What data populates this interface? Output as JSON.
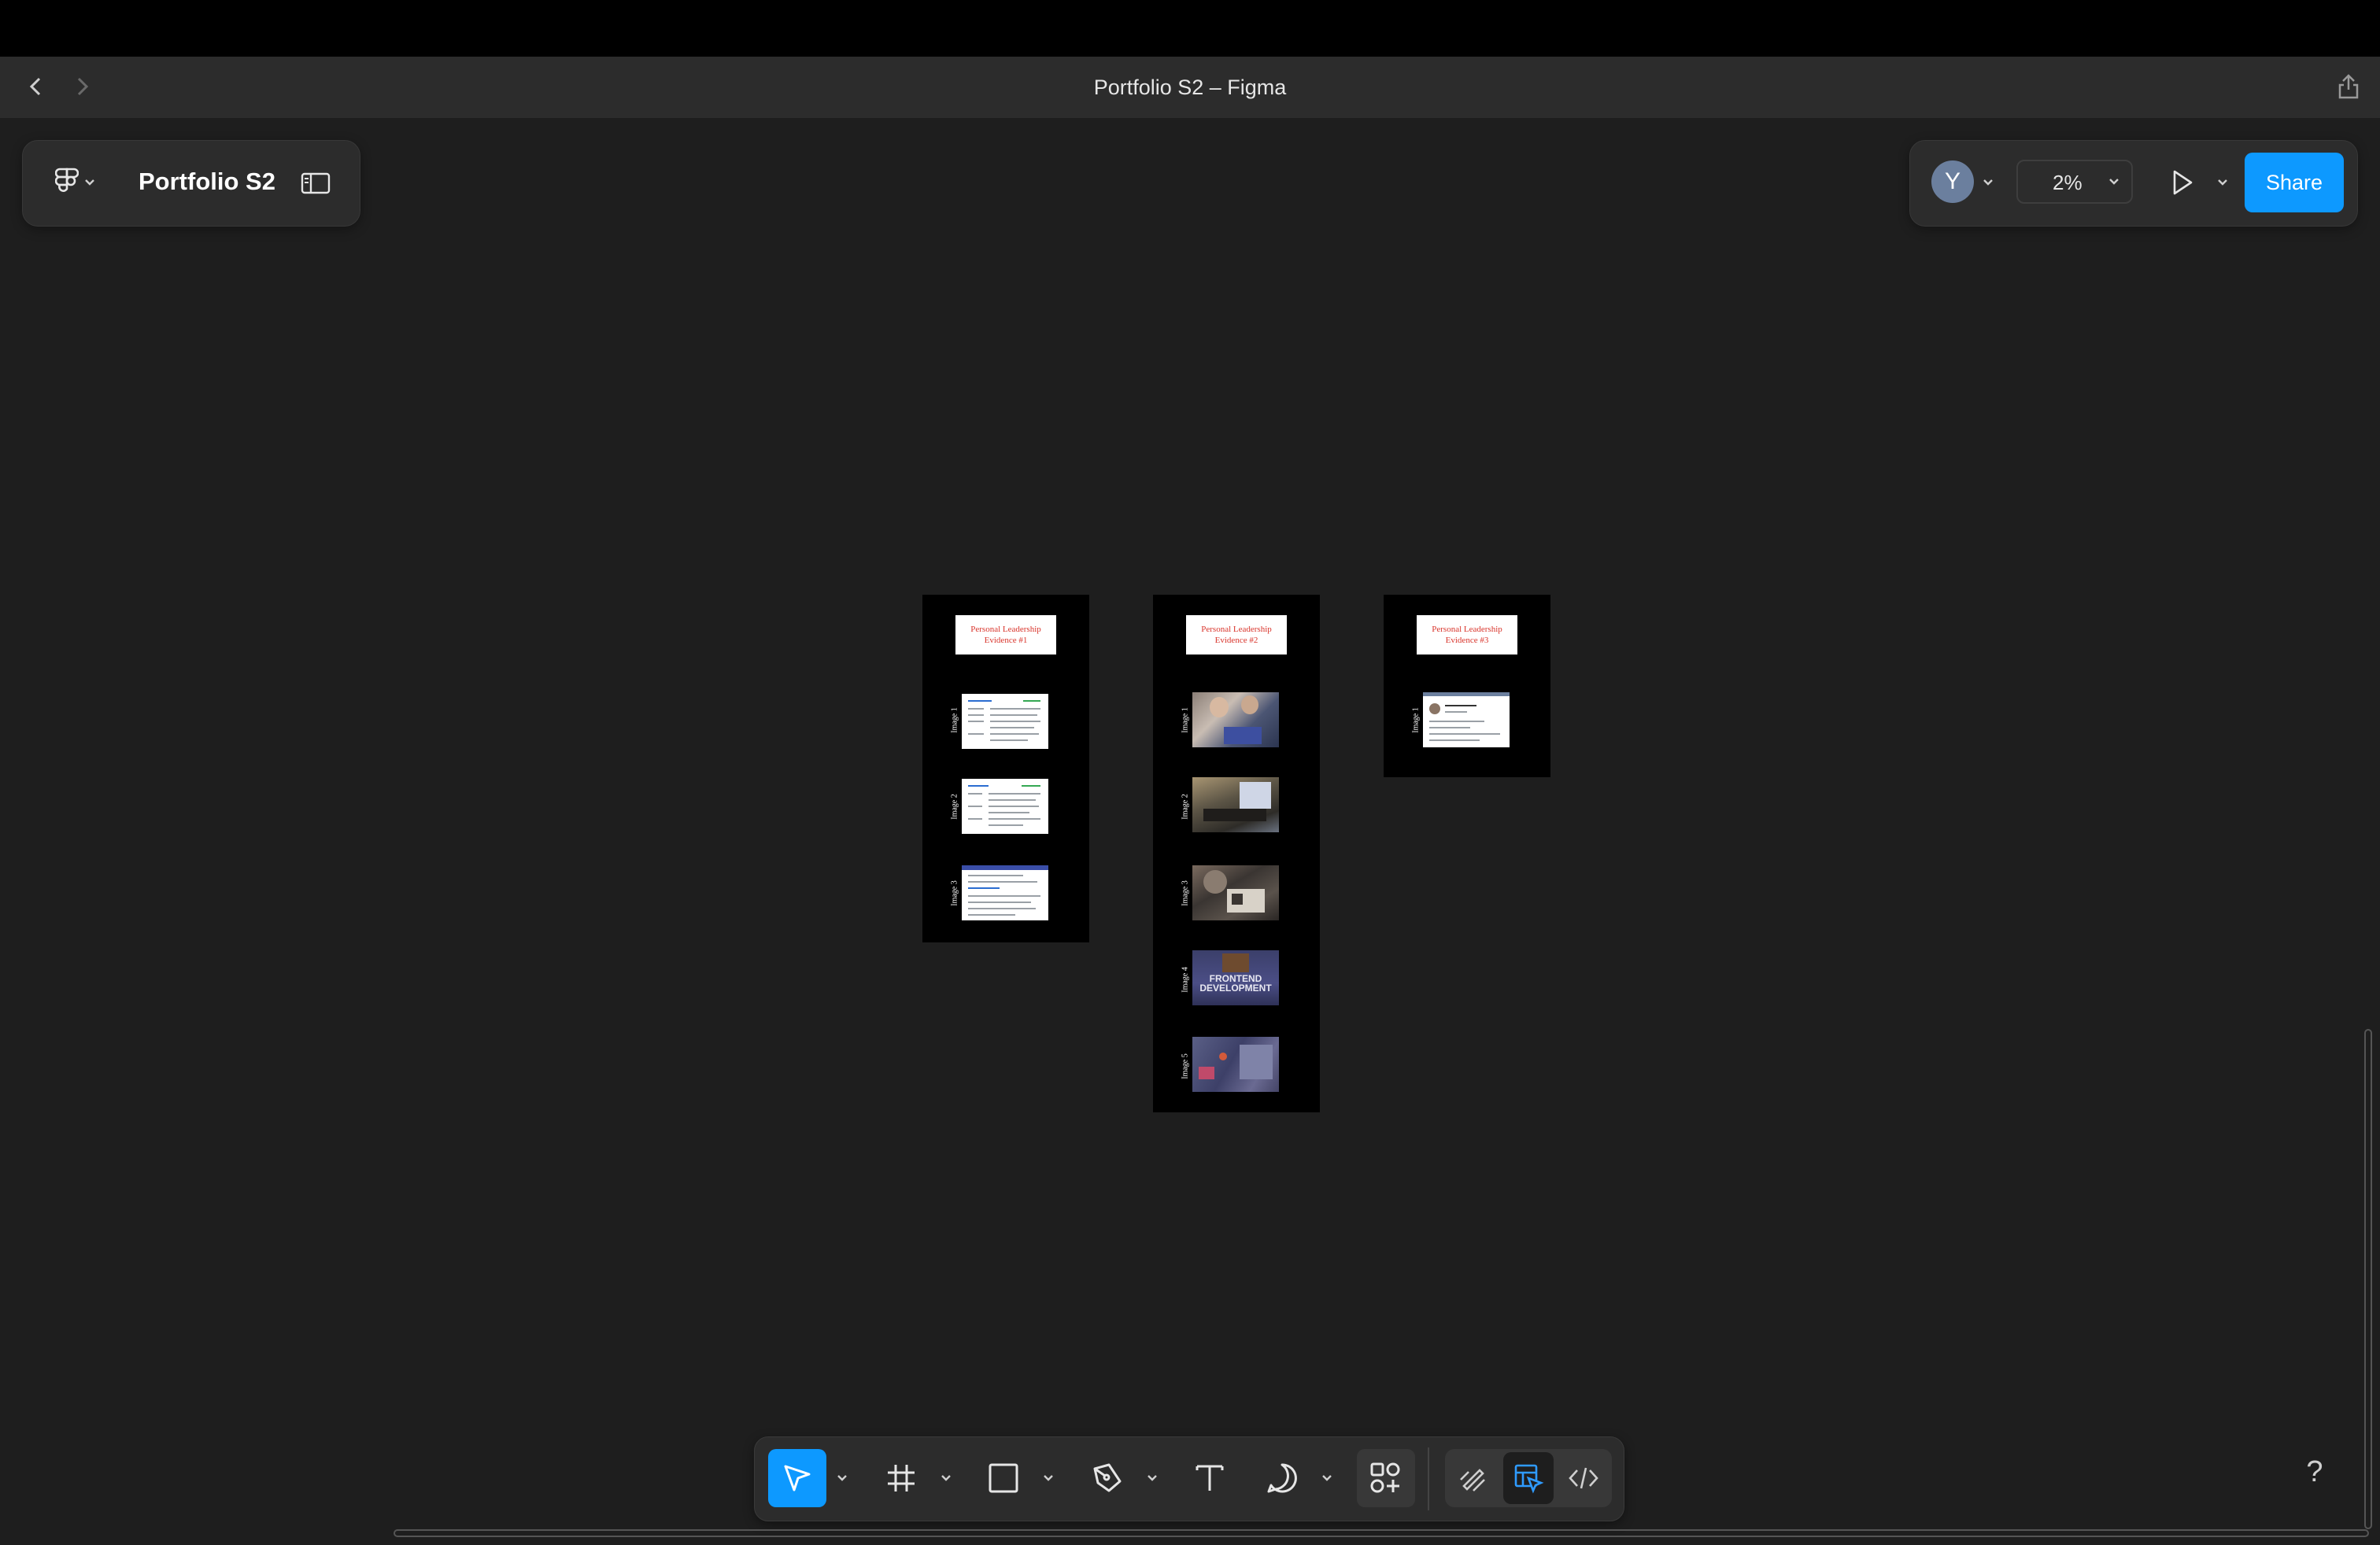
{
  "window": {
    "title": "Portfolio S2 – Figma"
  },
  "nav": {
    "back_icon": "chevron-left-icon",
    "forward_icon": "chevron-right-icon",
    "export_icon": "share-export-icon"
  },
  "file_panel": {
    "menu_icon": "figma-logo-icon",
    "file_name": "Portfolio S2",
    "sidebar_toggle_icon": "sidebar-toggle-icon"
  },
  "right_panel": {
    "avatar_initial": "Y",
    "zoom": "2%",
    "present_icon": "play-icon",
    "share_label": "Share"
  },
  "canvas": {
    "frames": [
      {
        "title": "Personal Leadership Evidence #1",
        "images": [
          {
            "label": "Image 1",
            "kind": "document"
          },
          {
            "label": "Image 2",
            "kind": "document"
          },
          {
            "label": "Image 3",
            "kind": "document"
          }
        ]
      },
      {
        "title": "Personal Leadership Evidence #2",
        "images": [
          {
            "label": "Image 1",
            "kind": "photo"
          },
          {
            "label": "Image 2",
            "kind": "photo"
          },
          {
            "label": "Image 3",
            "kind": "photo"
          },
          {
            "label": "Image 4",
            "kind": "photo",
            "caption": "FRONTEND DEVELOPMENT"
          },
          {
            "label": "Image 5",
            "kind": "photo"
          }
        ]
      },
      {
        "title": "Personal Leadership Evidence #3",
        "images": [
          {
            "label": "Image 1",
            "kind": "document"
          }
        ]
      }
    ]
  },
  "toolbar": {
    "tools": [
      "move-tool",
      "frame-tool",
      "shape-tool",
      "pen-tool",
      "text-tool",
      "comment-tool",
      "actions-tool"
    ],
    "modes": [
      "draw-mode",
      "design-mode",
      "dev-mode"
    ],
    "help_label": "?"
  },
  "colors": {
    "accent": "#0d99ff",
    "canvas": "#1e1e1e",
    "panel": "#2c2c2c",
    "frame_title_text": "#d9342b"
  }
}
